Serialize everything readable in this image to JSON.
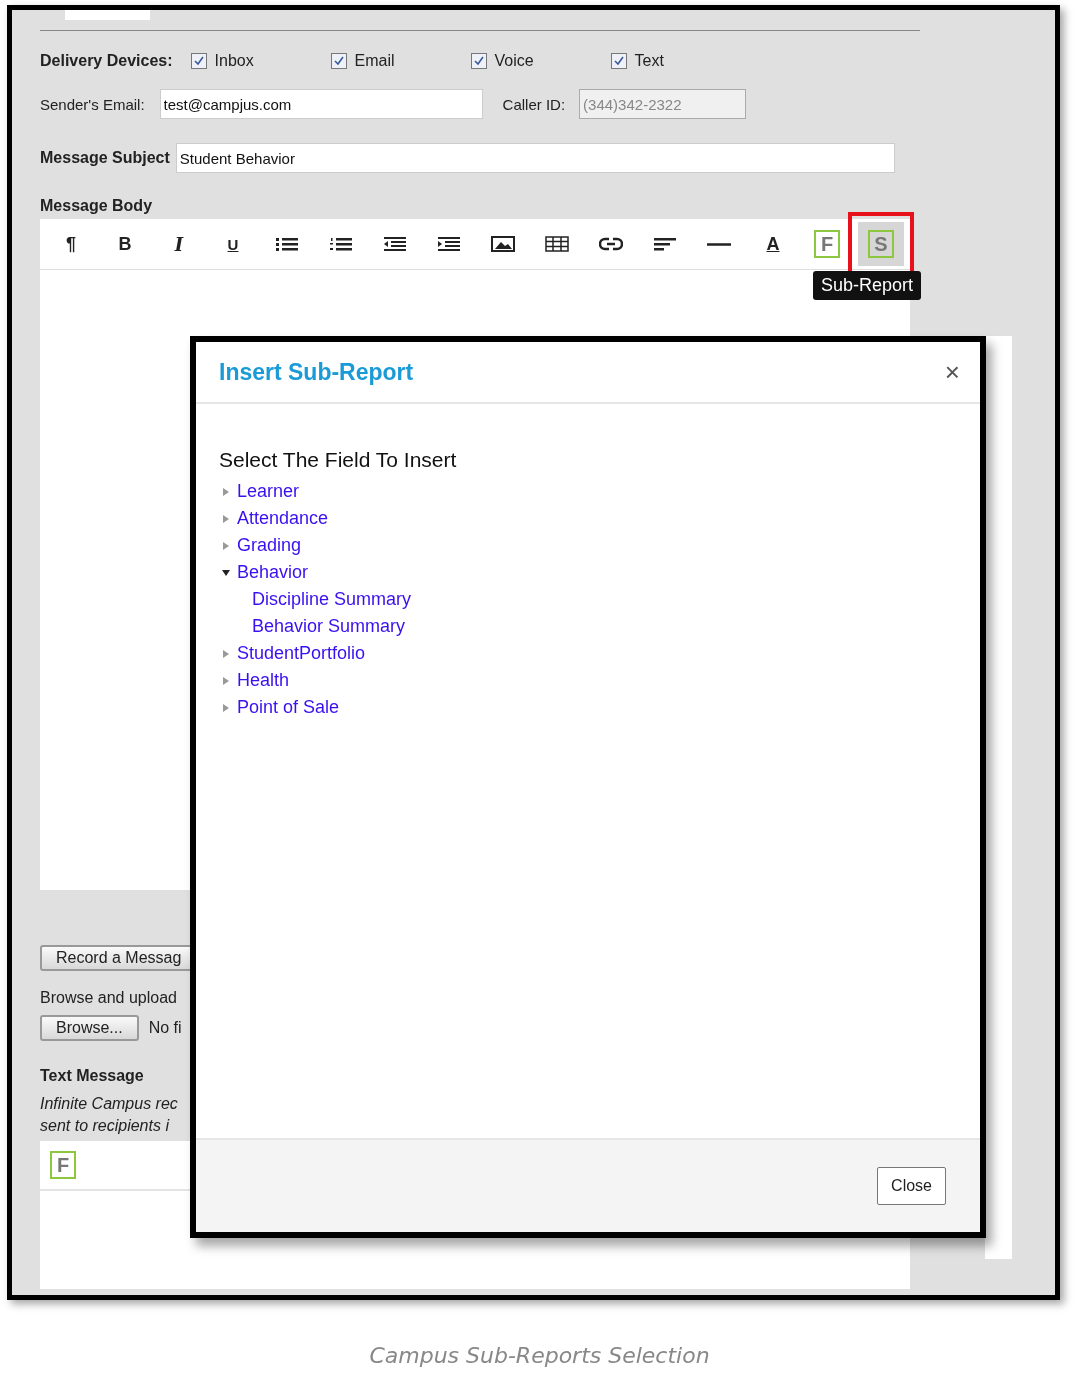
{
  "delivery_devices": {
    "label": "Delivery Devices:",
    "options": [
      {
        "label": "Inbox",
        "checked": true
      },
      {
        "label": "Email",
        "checked": true
      },
      {
        "label": "Voice",
        "checked": true
      },
      {
        "label": "Text",
        "checked": true
      }
    ]
  },
  "senders_email": {
    "label": "Sender's Email:",
    "value": "test@campjus.com"
  },
  "caller_id": {
    "label": "Caller ID:",
    "value": "(344)342-2322",
    "disabled": true
  },
  "message_subject": {
    "label": "Message Subject",
    "value": "Student Behavior"
  },
  "message_body": {
    "label": "Message Body",
    "toolbar": [
      {
        "kind": "paragraph",
        "glyph": "¶",
        "highlighted": false
      },
      {
        "kind": "bold",
        "glyph": "B",
        "highlighted": false
      },
      {
        "kind": "italic",
        "glyph": "I",
        "highlighted": false
      },
      {
        "kind": "underline",
        "glyph": "U",
        "highlighted": false
      },
      {
        "kind": "bullets",
        "highlighted": false
      },
      {
        "kind": "numbers",
        "highlighted": false
      },
      {
        "kind": "outdent",
        "highlighted": false
      },
      {
        "kind": "indent",
        "highlighted": false
      },
      {
        "kind": "image",
        "highlighted": false
      },
      {
        "kind": "table",
        "highlighted": false
      },
      {
        "kind": "link",
        "highlighted": false
      },
      {
        "kind": "align",
        "highlighted": false
      },
      {
        "kind": "rule",
        "highlighted": false
      },
      {
        "kind": "color",
        "glyph": "A",
        "highlighted": false
      },
      {
        "kind": "field",
        "glyph": "F",
        "highlighted": false
      },
      {
        "kind": "field",
        "glyph": "S",
        "highlighted": true
      }
    ],
    "tooltip": "Sub-Report"
  },
  "record_button": "Record a Messag",
  "browse_label": "Browse and upload",
  "browse_button": "Browse...",
  "file_status": "No fi",
  "text_message": {
    "label": "Text Message",
    "note_lines": [
      "Infinite Campus rec",
      "sent to recipients i"
    ],
    "toolbar_glyph": "F"
  },
  "dialog": {
    "title": "Insert Sub-Report",
    "close_icon": "×",
    "prompt": "Select The Field To Insert",
    "tree": [
      {
        "label": "Learner",
        "expanded": false
      },
      {
        "label": "Attendance",
        "expanded": false
      },
      {
        "label": "Grading",
        "expanded": false
      },
      {
        "label": "Behavior",
        "expanded": true,
        "children": [
          {
            "label": "Discipline Summary"
          },
          {
            "label": "Behavior Summary"
          }
        ]
      },
      {
        "label": "StudentPortfolio",
        "expanded": false
      },
      {
        "label": "Health",
        "expanded": false
      },
      {
        "label": "Point of Sale",
        "expanded": false
      }
    ],
    "close_button": "Close"
  },
  "caption": "Campus Sub-Reports Selection"
}
